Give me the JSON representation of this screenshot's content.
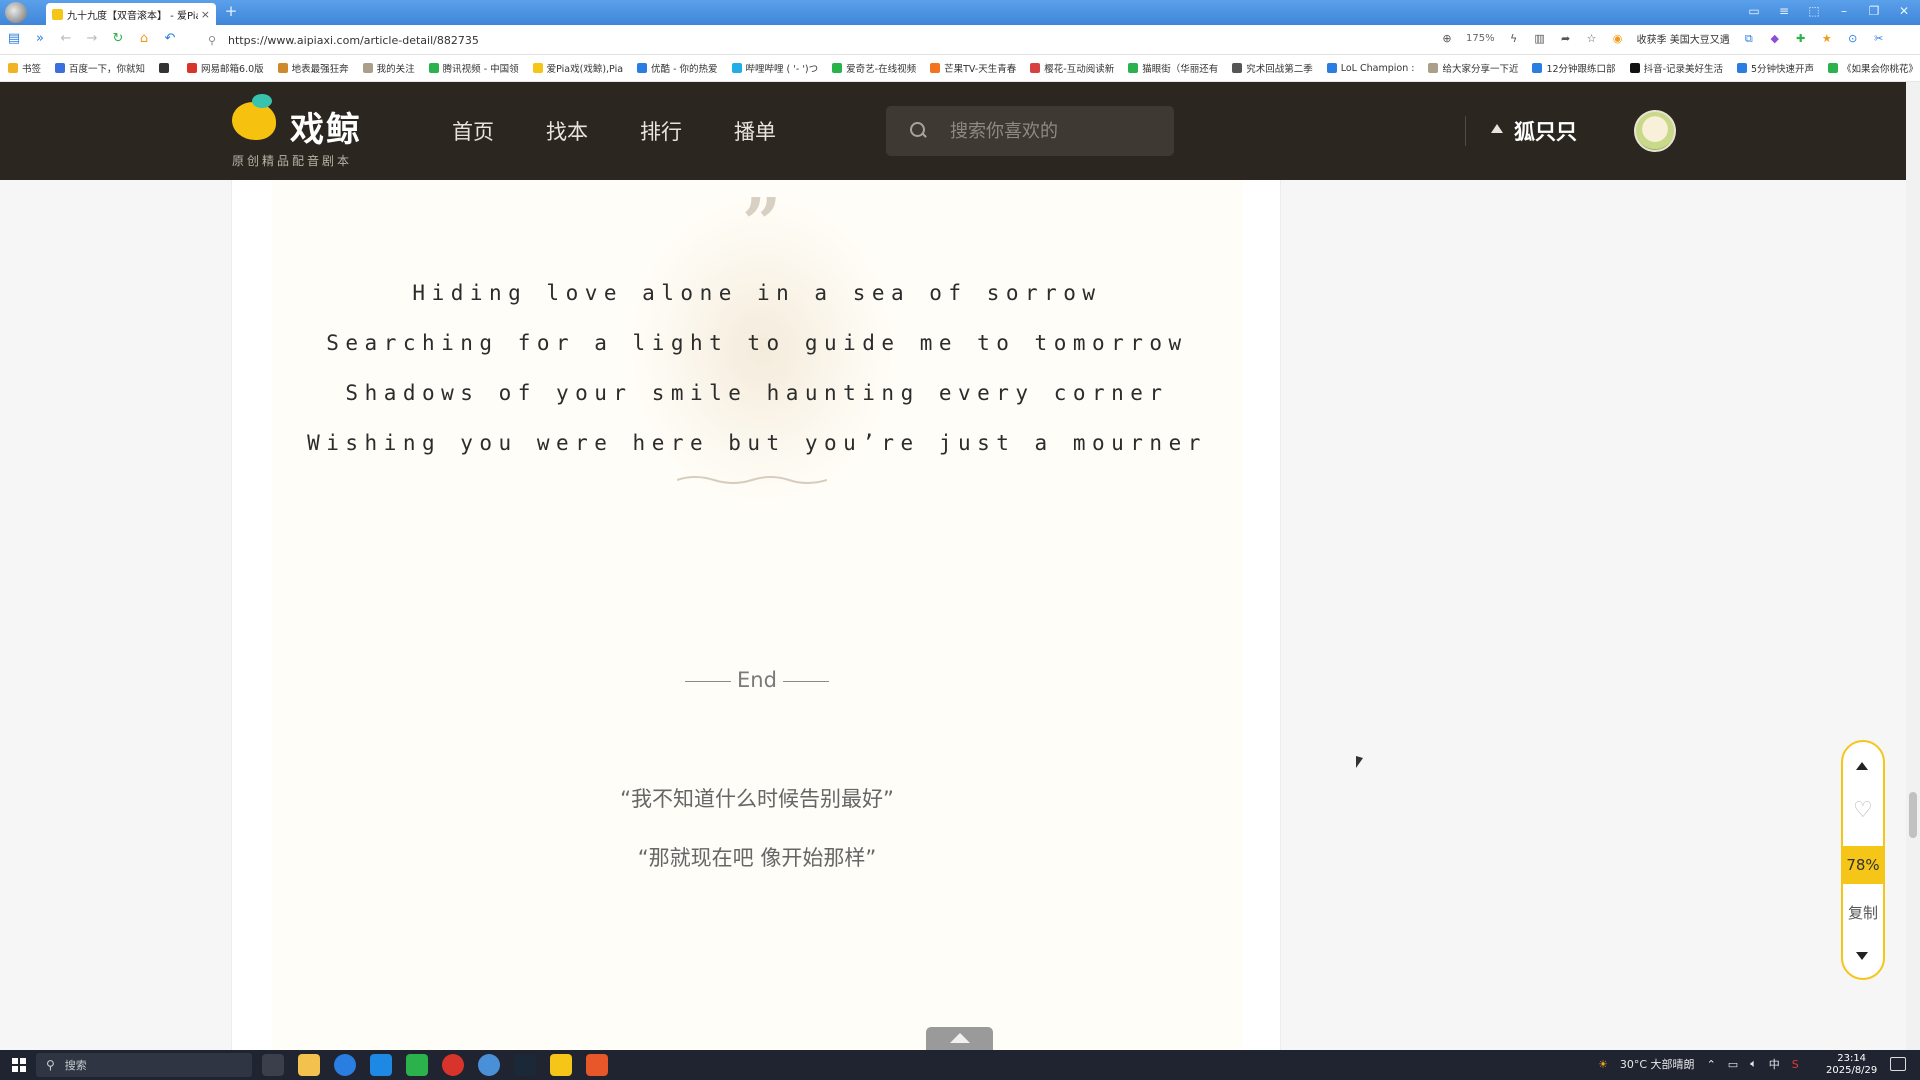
{
  "browser": {
    "tab_title": "九十九度【双音滚本】 - 爱Pia",
    "new_tab_glyph": "+",
    "close_glyph": "×",
    "url": "https://www.aipiaxi.com/article-detail/882735",
    "zoom": "175%",
    "news_ticker": "收获季 美国大豆又遇",
    "bookmarks": [
      {
        "label": "书签",
        "color": "#f0b323"
      },
      {
        "label": "百度一下，你就知",
        "color": "#3b6fe0"
      },
      {
        "label": "",
        "color": "#333333"
      },
      {
        "label": "网易邮箱6.0版",
        "color": "#d9342b"
      },
      {
        "label": "地表最强狂奔",
        "color": "#ce8a2a"
      },
      {
        "label": "我的关注",
        "color": "#aaa08a"
      },
      {
        "label": "腾讯视频 - 中国领",
        "color": "#2bb24c"
      },
      {
        "label": "爱Pia戏(戏鲸),Pia",
        "color": "#f5c518"
      },
      {
        "label": "优酷 - 你的热爱",
        "color": "#2a7de1"
      },
      {
        "label": "哔哩哔哩 ( '- ')つ",
        "color": "#23ade5"
      },
      {
        "label": "爱奇艺-在线视频",
        "color": "#27b24a"
      },
      {
        "label": "芒果TV-天生青春",
        "color": "#f3741f"
      },
      {
        "label": "樱花-互动阅读新",
        "color": "#d64040"
      },
      {
        "label": "猫眼街（华丽还有",
        "color": "#2bb24c"
      },
      {
        "label": "究术回战第二季",
        "color": "#555555"
      },
      {
        "label": "LoL Champion :",
        "color": "#2a7de1"
      },
      {
        "label": "给大家分享一下近",
        "color": "#aaa08a"
      },
      {
        "label": "12分钟跟练口部",
        "color": "#2a7de1"
      },
      {
        "label": "抖音-记录美好生活",
        "color": "#111111"
      },
      {
        "label": "5分钟快速开声",
        "color": "#2a7de1"
      },
      {
        "label": "《如果会你桃花》",
        "color": "#2bb24c"
      }
    ]
  },
  "site": {
    "logo_text": "戏鲸",
    "logo_sub": "原创精品配音剧本",
    "nav": [
      "首页",
      "找本",
      "排行",
      "播单"
    ],
    "search_placeholder": "搜索你喜欢的",
    "user_name": "狐只只"
  },
  "article": {
    "quote_glyph": "”",
    "lyrics": [
      "Hiding love alone in a sea of sorrow",
      "Searching for a light to guide me to tomorrow",
      "Shadows of your smile haunting every corner",
      "Wishing you were here but you’re just a mourner"
    ],
    "end_label": "End",
    "closing_lines": [
      "“我不知道什么时候告别最好”",
      "“那就现在吧 像开始那样”"
    ]
  },
  "side_tool": {
    "progress_label": "78%",
    "copy_label": "复制"
  },
  "taskbar": {
    "search_label": "搜索",
    "weather": "30°C 大部晴朗",
    "ime": "中",
    "time": "23:14",
    "date": "2025/8/29"
  },
  "colors": {
    "header_bg": "#2b2720",
    "accent_yellow": "#f5c518",
    "paper_bg": "#fffdf7"
  }
}
